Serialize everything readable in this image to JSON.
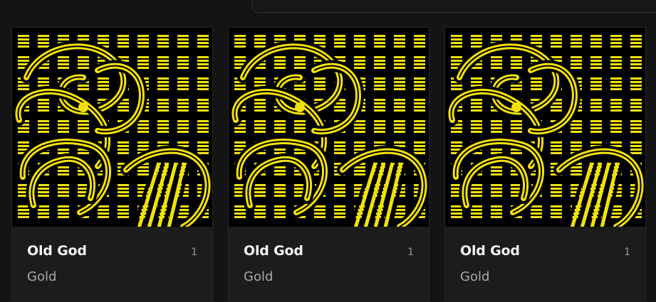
{
  "cards": [
    {
      "title": "Old God",
      "subtitle": "Gold",
      "count": "1"
    },
    {
      "title": "Old God",
      "subtitle": "Gold",
      "count": "1"
    },
    {
      "title": "Old God",
      "subtitle": "Gold",
      "count": "1"
    }
  ],
  "art": {
    "name": "yellow-abstract-artwork",
    "accent": "#f2e20a",
    "background": "#000000"
  }
}
